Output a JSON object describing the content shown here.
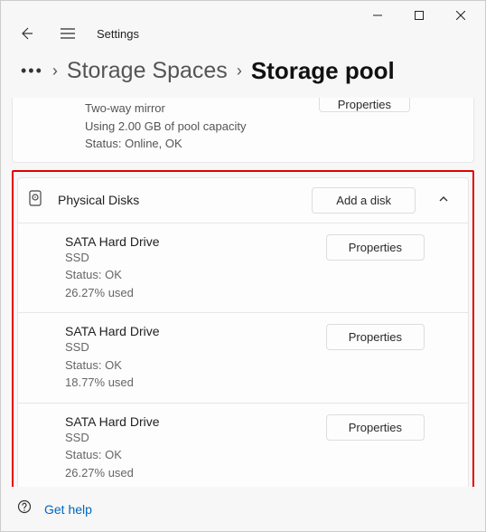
{
  "window": {
    "app_title": "Settings"
  },
  "breadcrumb": {
    "parent": "Storage Spaces",
    "current": "Storage pool"
  },
  "space_partial": {
    "line1": "Two-way mirror",
    "line2": "Using 2.00 GB of pool capacity",
    "line3": "Status: Online, OK",
    "properties_label": "Properties"
  },
  "physical_disks": {
    "header": "Physical Disks",
    "add_label": "Add a disk"
  },
  "disks": [
    {
      "name": "SATA Hard Drive",
      "type": "SSD",
      "status": "Status: OK",
      "used": "26.27% used",
      "properties_label": "Properties"
    },
    {
      "name": "SATA Hard Drive",
      "type": "SSD",
      "status": "Status: OK",
      "used": "18.77% used",
      "properties_label": "Properties"
    },
    {
      "name": "SATA Hard Drive",
      "type": "SSD",
      "status": "Status: OK",
      "used": "26.27% used",
      "properties_label": "Properties"
    }
  ],
  "footer": {
    "help": "Get help"
  }
}
